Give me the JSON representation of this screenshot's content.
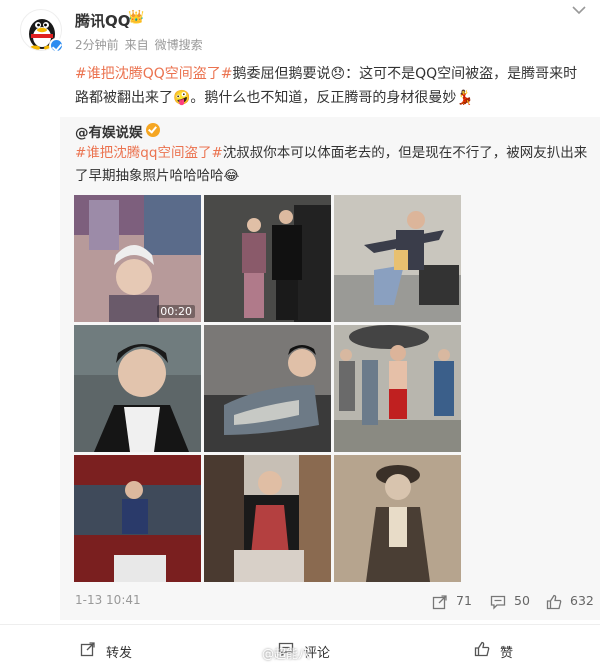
{
  "account": {
    "name": "腾讯QQ",
    "crown_icon": "crown-icon",
    "time": "2分钟前",
    "source_prefix": "来自",
    "source": "微博搜索"
  },
  "post": {
    "hashtag": "#谁把沈腾QQ空间盗了#",
    "text": "鹅委屈但鹅要说😞：这可不是QQ空间被盗，是腾哥来时路都被翻出来了🤪。鹅什么也不知道，反正腾哥的身材很曼妙💃"
  },
  "repost": {
    "author": "@有娱说娱",
    "hashtag": "#谁把沈腾qq空间盗了#",
    "text": "沈叔叔你本可以体面老去的，但是现在不行了，被网友扒出来了早期抽象照片哈哈哈哈😂",
    "video_duration": "00:20",
    "images": [
      "photo-1",
      "photo-2",
      "photo-3",
      "photo-4",
      "photo-5",
      "photo-6",
      "photo-7",
      "photo-8",
      "photo-9"
    ],
    "date": "1-13 10:41",
    "reposts": "71",
    "comments": "50",
    "likes": "632"
  },
  "actions": {
    "repost_label": "转发",
    "comment_label": "评论",
    "like_label": "赞"
  },
  "watermark": "@超能八"
}
